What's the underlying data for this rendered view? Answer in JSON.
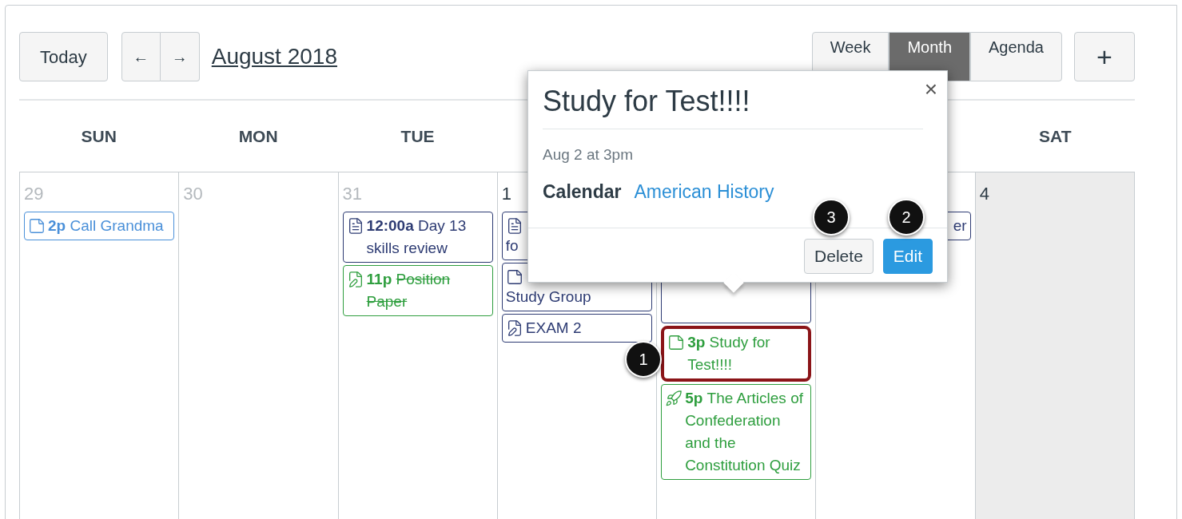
{
  "toolbar": {
    "today": "Today",
    "prev": "←",
    "next": "→",
    "month_title": "August 2018",
    "views": [
      {
        "label": "Week",
        "selected": false
      },
      {
        "label": "Month",
        "selected": true
      },
      {
        "label": "Agenda",
        "selected": false
      }
    ],
    "add": "+"
  },
  "weekdays": [
    {
      "label": "SUN"
    },
    {
      "label": "MON"
    },
    {
      "label": "TUE"
    },
    {
      "label": "SAT"
    }
  ],
  "days": [
    {
      "number": "29",
      "other_month": true,
      "events": [
        {
          "kind": "note",
          "time": "2p",
          "title": "Call Grandma",
          "color": "#4a90d9"
        }
      ]
    },
    {
      "number": "30",
      "other_month": true
    },
    {
      "number": "31",
      "other_month": true,
      "events": [
        {
          "kind": "document",
          "time": "12:00a",
          "title": "Day 13 skills review",
          "color": "#2d3b73"
        },
        {
          "kind": "assignment",
          "time": "11p",
          "title": "Position Paper",
          "color": "#2e9e3e",
          "strikethrough": true
        }
      ]
    },
    {
      "number": "1",
      "other_month": false,
      "events": [
        {
          "kind": "document",
          "title": "fo",
          "color": "#2d3b73",
          "wrap": true
        },
        {
          "kind": "note",
          "title": "Study Group",
          "color": "#2d3b73",
          "wrap": true
        },
        {
          "kind": "assignment",
          "title": "EXAM 2",
          "color": "#2d3b73"
        }
      ]
    },
    {
      "events": [
        {
          "kind": "covered",
          "color": "#2d3b73"
        },
        {
          "kind": "note",
          "time": "3p",
          "title": "Study for Test!!!!",
          "color": "#2e9e3e",
          "highlighted": true
        },
        {
          "kind": "quiz",
          "time": "5p",
          "title": "The Articles of Confederation and the Constitution Quiz",
          "color": "#2e9e3e"
        }
      ]
    },
    {
      "events": [
        {
          "title": "er",
          "color": "#2d3b73",
          "right_aligned": true
        }
      ]
    },
    {
      "number": "4",
      "other_month": false,
      "today": true
    }
  ],
  "popover": {
    "title": "Study for Test!!!!",
    "date": "Aug 2 at 3pm",
    "calendar_label": "Calendar",
    "calendar_value": "American History",
    "close": "×",
    "buttons": [
      {
        "label": "Delete",
        "kind": "secondary"
      },
      {
        "label": "Edit",
        "kind": "primary"
      }
    ]
  },
  "callouts": [
    {
      "label": "1"
    },
    {
      "label": "3"
    },
    {
      "label": "2"
    }
  ]
}
